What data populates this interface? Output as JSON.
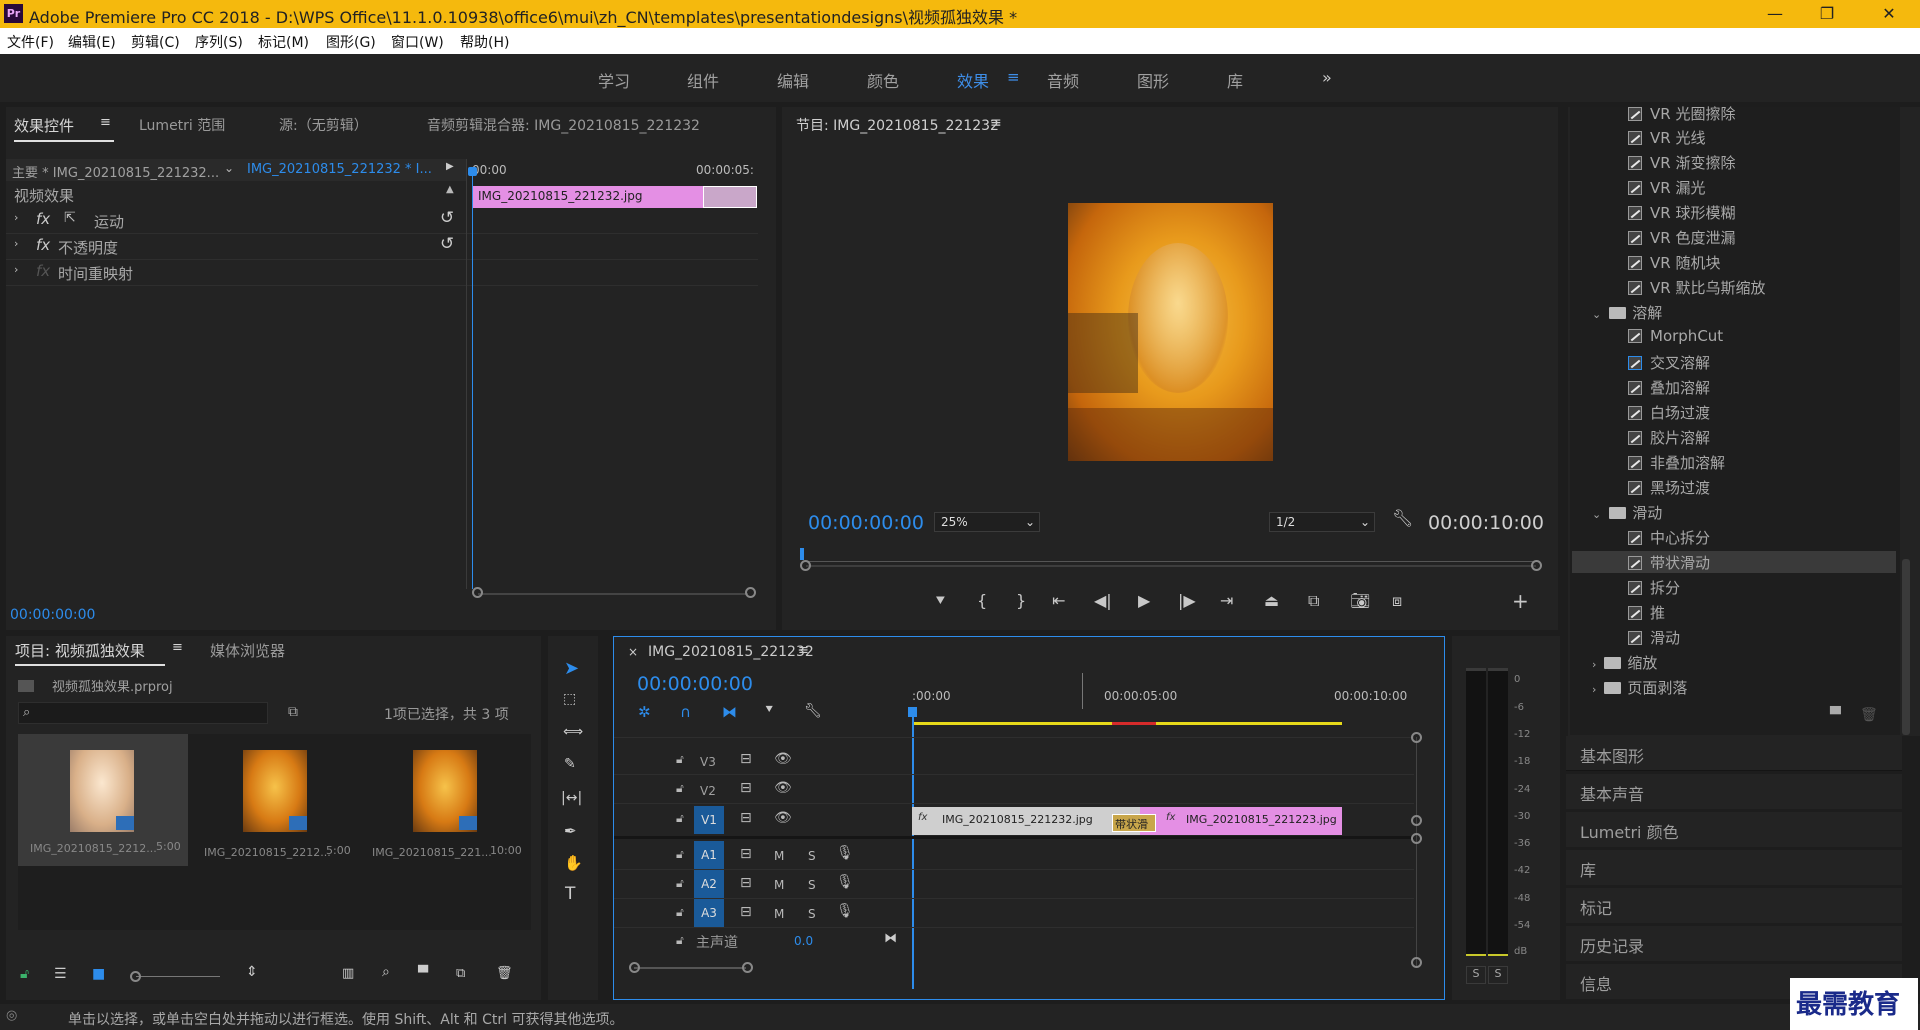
{
  "titlebar": {
    "logo": "Pr",
    "title": "Adobe Premiere Pro CC 2018 - D:\\WPS Office\\11.1.0.10938\\office6\\mui\\zh_CN\\templates\\presentationdesigns\\视频孤独效果 *",
    "min": "—",
    "max": "❐",
    "close": "✕"
  },
  "menu": [
    "文件(F)",
    "编辑(E)",
    "剪辑(C)",
    "序列(S)",
    "标记(M)",
    "图形(G)",
    "窗口(W)",
    "帮助(H)"
  ],
  "workspaces": [
    "学习",
    "组件",
    "编辑",
    "颜色",
    "效果",
    "音频",
    "图形",
    "库"
  ],
  "workspace_more": "»",
  "effect_controls": {
    "tabs": [
      "效果控件",
      "Lumetri 范围",
      "源:（无剪辑）",
      "音频剪辑混合器: IMG_20210815_221232"
    ],
    "master": "主要 * IMG_20210815_221232...",
    "sequence": "IMG_20210815_221232 * I...",
    "t_start": "00:00",
    "t_end": "00:00:05:",
    "clip": "IMG_20210815_221232.jpg",
    "section": "视频效果",
    "rows": [
      "运动",
      "不透明度",
      "时间重映射"
    ],
    "fx": "fx",
    "timecode": "00:00:00:00"
  },
  "program": {
    "title": "节目: IMG_20210815_221232",
    "timecode": "00:00:00:00",
    "zoom": "25%",
    "quality": "1/2",
    "duration": "00:00:10:00"
  },
  "effects_list": {
    "items_top": [
      "VR 光圈擦除",
      "VR 光线",
      "VR 渐变擦除",
      "VR 漏光",
      "VR 球形模糊",
      "VR 色度泄漏",
      "VR 随机块",
      "VR 默比乌斯缩放"
    ],
    "folder_dissolve": "溶解",
    "dissolve": [
      "MorphCut",
      "交叉溶解",
      "叠加溶解",
      "白场过渡",
      "胶片溶解",
      "非叠加溶解",
      "黑场过渡"
    ],
    "folder_slide": "滑动",
    "slide": [
      "中心拆分",
      "带状滑动",
      "拆分",
      "推",
      "滑动"
    ],
    "folder_zoom": "缩放",
    "folder_page": "页面剥落"
  },
  "side_panels": [
    "基本图形",
    "基本声音",
    "Lumetri 颜色",
    "库",
    "标记",
    "历史记录",
    "信息"
  ],
  "project": {
    "tab": "项目: 视频孤独效果",
    "tab2": "媒体浏览器",
    "file": "视频孤独效果.prproj",
    "selection": "1项已选择，共 3 项",
    "items": [
      {
        "name": "IMG_20210815_2212...",
        "dur": "5:00"
      },
      {
        "name": "IMG_20210815_2212...",
        "dur": "5:00"
      },
      {
        "name": "IMG_20210815_221...",
        "dur": "10:00"
      }
    ]
  },
  "timeline": {
    "tab": "IMG_20210815_221232",
    "timecode": "00:00:00:00",
    "ruler": [
      ":00:00",
      "00:00:05:00",
      "00:00:10:00"
    ],
    "video_tracks": [
      "V3",
      "V2",
      "V1"
    ],
    "audio_tracks": [
      "A1",
      "A2",
      "A3"
    ],
    "master": "主声道",
    "master_val": "0.0",
    "clip1": "IMG_20210815_221232.jpg",
    "clip2": "IMG_20210815_221223.jpg",
    "transition": "带状滑",
    "M": "M",
    "S": "S"
  },
  "meter": {
    "ticks": [
      "0",
      "-6",
      "-12",
      "-18",
      "-24",
      "-30",
      "-36",
      "-42",
      "-48",
      "-54",
      "dB"
    ],
    "solo": [
      "S",
      "S"
    ]
  },
  "status": "单击以选择，或单击空白处并拖动以进行框选。使用 Shift、Alt 和 Ctrl 可获得其他选项。",
  "watermark": "最需教育",
  "colors": {
    "accent": "#2d8ceb",
    "titlebar": "#f5b90d",
    "clip_pink": "#e48fe4",
    "panel": "#232323"
  }
}
